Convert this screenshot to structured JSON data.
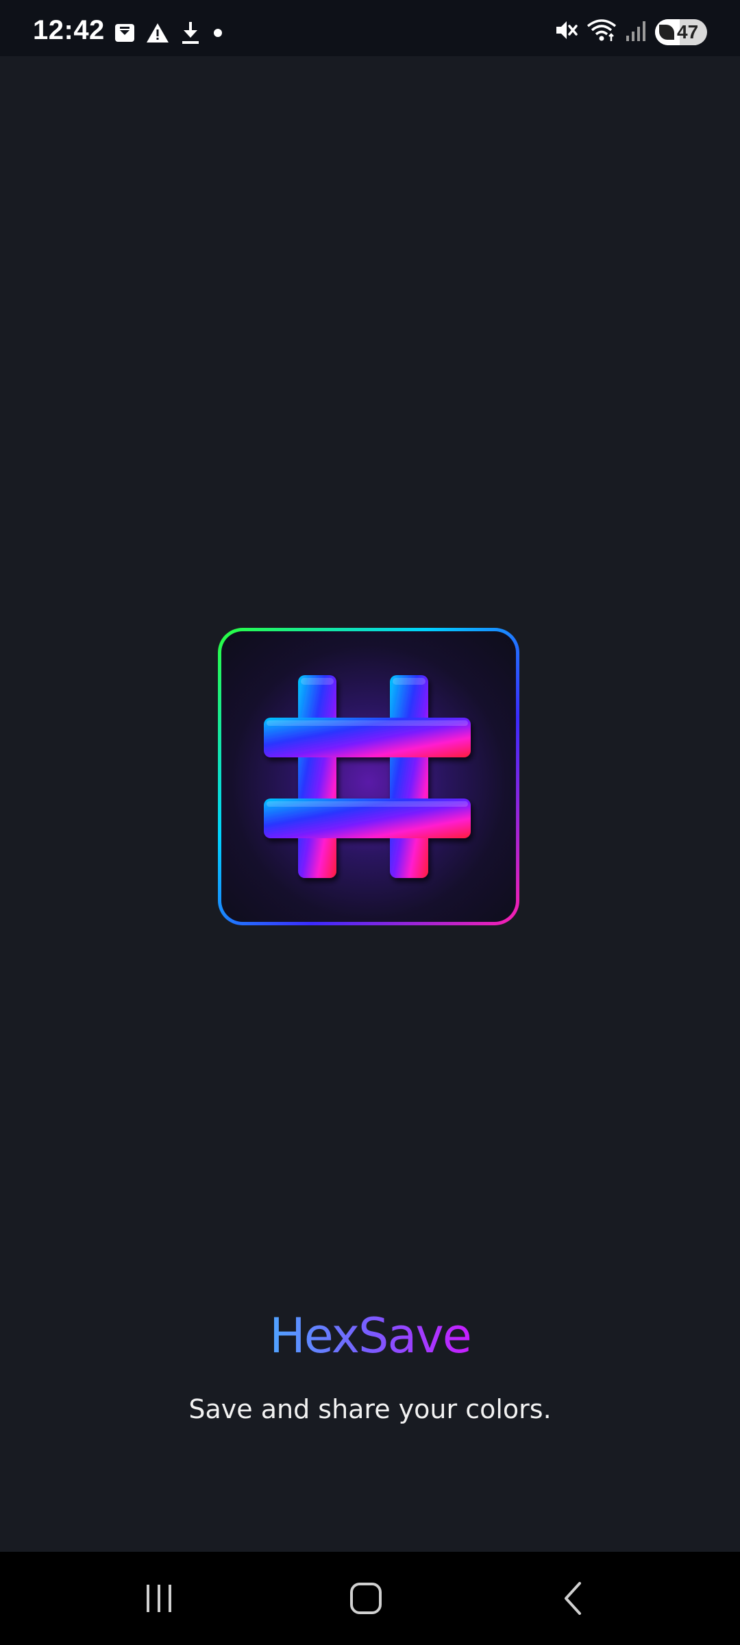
{
  "status_bar": {
    "time": "12:42",
    "battery_level": "47",
    "battery_percent": 47,
    "left_icons": [
      "notification-box-icon",
      "warning-icon",
      "download-icon",
      "dot-icon"
    ],
    "right_icons": [
      "mute-icon",
      "wifi-icon",
      "signal-icon",
      "battery-icon"
    ]
  },
  "app": {
    "name": "HexSave",
    "tagline": "Save and share your colors.",
    "logo_icon": "hash-logo-icon",
    "colors": {
      "background": "#181b22",
      "title_gradient_start": "#4fa4ff",
      "title_gradient_end": "#c81dff",
      "logo_border_start": "#2bff3c",
      "logo_border_end": "#ff1fb0"
    }
  },
  "nav_bar": {
    "buttons": [
      "recent-apps-icon",
      "home-icon",
      "back-icon"
    ]
  }
}
